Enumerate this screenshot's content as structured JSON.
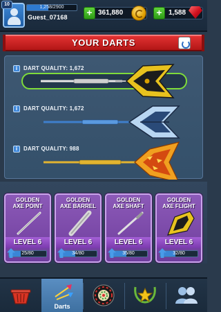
{
  "player": {
    "level": "10",
    "xp_text": "1,258/2900",
    "xp_fraction": 0.434,
    "username": "Guest_07168"
  },
  "currency": {
    "coins": "361,880",
    "gems": "1,588"
  },
  "banner": {
    "title": "YOUR DARTS"
  },
  "darts": [
    {
      "quality_label": "DART QUALITY: 1,672",
      "selected": true,
      "flight_color": "#e8c21e",
      "barrel_color": "#d8d8d8"
    },
    {
      "quality_label": "DART QUALITY: 1,672",
      "selected": false,
      "flight_color": "#b8d6f2",
      "barrel_color": "#5a9ae0"
    },
    {
      "quality_label": "DART QUALITY: 988",
      "selected": false,
      "flight_color": "#f0a020",
      "barrel_color": "#e2b430"
    }
  ],
  "parts": [
    {
      "name_line1": "GOLDEN",
      "name_line2": "AXE POINT",
      "level": "LEVEL 6",
      "progress": "25/80",
      "fraction": 0.3125
    },
    {
      "name_line1": "GOLDEN",
      "name_line2": "AXE BARREL",
      "level": "LEVEL 6",
      "progress": "34/80",
      "fraction": 0.425
    },
    {
      "name_line1": "GOLDEN",
      "name_line2": "AXE SHAFT",
      "level": "LEVEL 6",
      "progress": "35/80",
      "fraction": 0.4375
    },
    {
      "name_line1": "GOLDEN",
      "name_line2": "AXE FLIGHT",
      "level": "LEVEL 6",
      "progress": "32/80",
      "fraction": 0.4
    }
  ],
  "nav": {
    "shop_icon": "basket-icon",
    "darts_label": "Darts",
    "board_icon": "dartboard-icon",
    "trophy_icon": "trophy-icon",
    "friends_icon": "friends-icon"
  },
  "colors": {
    "accent_red": "#d42020",
    "card_purple": "#7a46a8",
    "selected_green": "#7fdc3a"
  }
}
